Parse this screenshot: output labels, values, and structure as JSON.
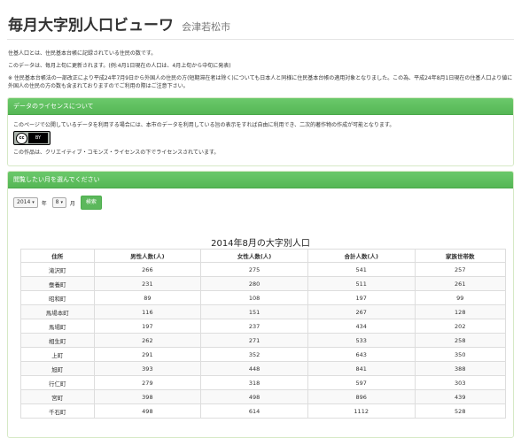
{
  "header": {
    "title": "毎月大字別人口ビューワ",
    "subtitle": "会津若松市"
  },
  "intro": {
    "line1": "住基人口とは、住民基本台帳に記録されている住民の数です。",
    "line2": "このデータは、毎月上旬に更新されます。(例:4月1日現在の人口は、4月上旬から中旬に発表)",
    "note": "※ 住民基本台帳法の一部改正により平成24年7月9日から外国人の住民の方(短期滞在者は除く)についても日本人と同様に住民基本台帳の適用対象となりました。この為、平成24年8月1日現在の住基人口より値に外国人の住民の方の数も含まれておりますのでご利用の際はご注意下さい。"
  },
  "license_panel": {
    "heading": "データのライセンスについて",
    "text": "このページで公開しているデータを利用する場合には、本市のデータを利用している旨の表示をすれば自由に利用でき、二次的著作物の作成が可能となります。",
    "badge_cc": "cc",
    "badge_by": "BY",
    "note": "この作品は、クリエイティブ・コモンズ・ライセンスの下でライセンスされています。"
  },
  "select_panel": {
    "heading": "閲覧したい月を選んでください",
    "year_value": "2014",
    "year_unit": "年",
    "month_value": "8",
    "month_unit": "月",
    "search_label": "検索"
  },
  "table_title": "2014年8月の大字別人口",
  "table": {
    "headers": [
      "住所",
      "男性人数(人)",
      "女性人数(人)",
      "合計人数(人)",
      "家族世帯数"
    ],
    "rows": [
      [
        "滝沢町",
        "266",
        "275",
        "541",
        "257"
      ],
      [
        "蚕養町",
        "231",
        "280",
        "511",
        "261"
      ],
      [
        "昭和町",
        "89",
        "108",
        "197",
        "99"
      ],
      [
        "馬場本町",
        "116",
        "151",
        "267",
        "128"
      ],
      [
        "馬場町",
        "197",
        "237",
        "434",
        "202"
      ],
      [
        "相生町",
        "262",
        "271",
        "533",
        "258"
      ],
      [
        "上町",
        "291",
        "352",
        "643",
        "350"
      ],
      [
        "旭町",
        "393",
        "448",
        "841",
        "388"
      ],
      [
        "行仁町",
        "279",
        "318",
        "597",
        "303"
      ],
      [
        "宮町",
        "398",
        "498",
        "896",
        "439"
      ],
      [
        "千石町",
        "498",
        "614",
        "1112",
        "528"
      ]
    ]
  }
}
